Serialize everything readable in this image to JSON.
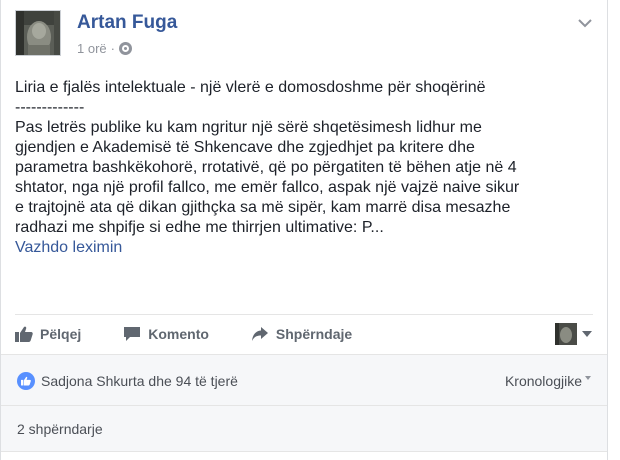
{
  "post": {
    "author": "Artan Fuga",
    "time": "1 orë",
    "privacy_icon": "globe-icon",
    "menu_icon": "chevron-down-icon",
    "body": {
      "line1": "Liria e fjalës intelektuale - një vlerë e domosdoshme për shoqërinë",
      "divider": "-------------",
      "line2": "Pas letrës publike ku kam ngritur një sërë shqetësimesh lidhur me",
      "line3": "gjendjen e Akademisë të Shkencave dhe zgjedhjet pa kritere dhe",
      "line4": "parametra bashkëkohorë, rrotativë, që po përgatiten të bëhen atje në 4",
      "line5": "shtator, nga një profil fallco, me emër fallco, aspak një vajzë naive sikur",
      "line6": "e trajtojnë ata që dikan gjithçka sa më sipër, kam marrë disa mesazhe",
      "line7": "radhazi me shpifje si edhe me thirrjen ultimative: P...",
      "continue": "Vazhdo leximin"
    }
  },
  "actions": {
    "like": "Pëlqej",
    "comment": "Komento",
    "share": "Shpërndaje"
  },
  "reactions": {
    "summary": "Sadjona Shkurta dhe 94 të tjerë",
    "order": "Kronologjike"
  },
  "shares": {
    "count": "2 shpërndarje"
  },
  "colors": {
    "link": "#365899",
    "muted": "#90949c",
    "like_blue": "#5890ff",
    "panel": "#f6f7f9"
  }
}
